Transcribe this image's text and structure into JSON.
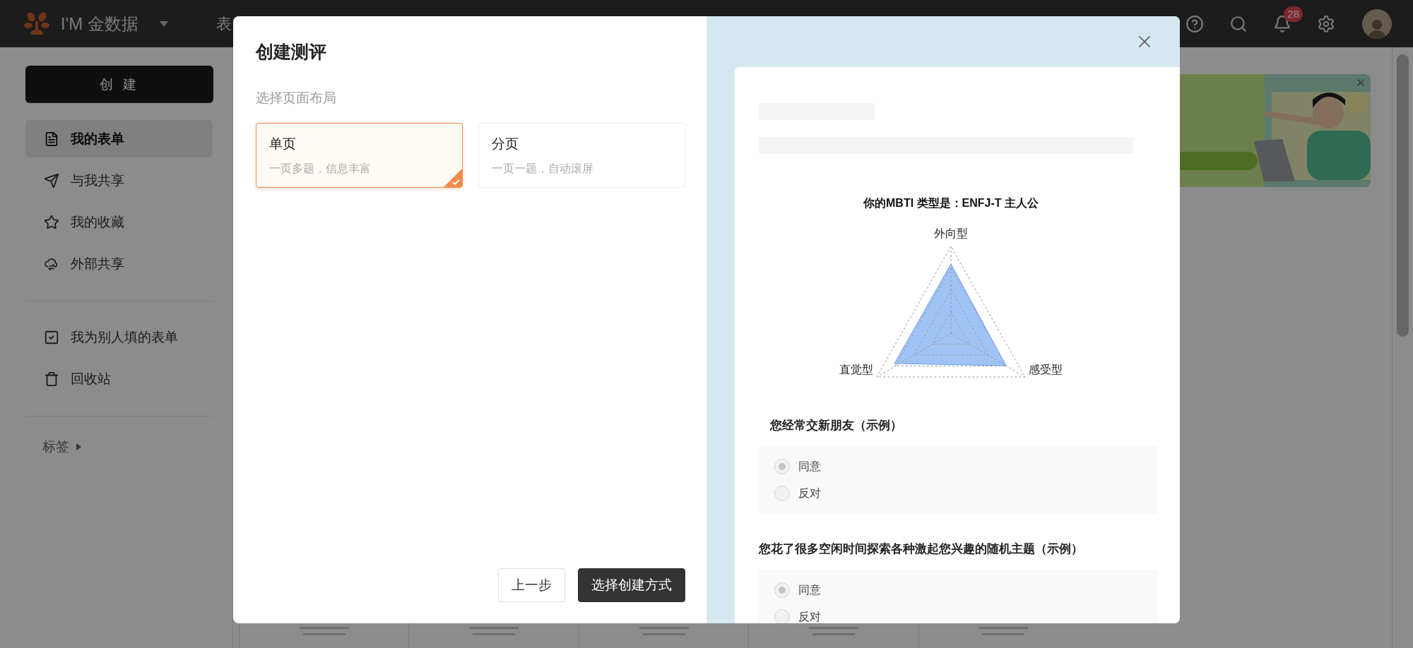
{
  "top_bar": {
    "brand": "I'M 金数据",
    "nav_partial": "表",
    "notification_count": "28"
  },
  "sidebar": {
    "create_button": "创 建",
    "groups": [
      {
        "items": [
          {
            "label": "我的表单",
            "selected": true
          },
          {
            "label": "与我共享",
            "selected": false
          },
          {
            "label": "我的收藏",
            "selected": false
          },
          {
            "label": "外部共享",
            "selected": false
          }
        ]
      },
      {
        "items": [
          {
            "label": "我为别人填的表单",
            "selected": false
          },
          {
            "label": "回收站",
            "selected": false
          }
        ]
      }
    ],
    "section": "标签"
  },
  "dialog": {
    "title": "创建测评",
    "subtitle": "选择页面布局",
    "layouts": [
      {
        "title": "单页",
        "description": "一页多题，信息丰富",
        "selected": true
      },
      {
        "title": "分页",
        "description": "一页一题，自动滚屏",
        "selected": false
      }
    ],
    "buttons": [
      {
        "label": "上一步",
        "kind": "secondary"
      },
      {
        "label": "选择创建方式",
        "kind": "primary"
      }
    ],
    "preview": {
      "result_title": "你的MBTI 类型是：ENFJ-T 主人公",
      "axes": [
        "外向型",
        "直觉型",
        "感受型"
      ],
      "questions": [
        {
          "text": "您经常交新朋友（示例）",
          "options": [
            {
              "label": "同意",
              "selected": true
            },
            {
              "label": "反对",
              "selected": false
            }
          ]
        },
        {
          "text": "您花了很多空闲时间探索各种激起您兴趣的随机主题（示例）",
          "options": [
            {
              "label": "同意",
              "selected": true
            },
            {
              "label": "反对",
              "selected": false
            }
          ]
        }
      ]
    }
  }
}
